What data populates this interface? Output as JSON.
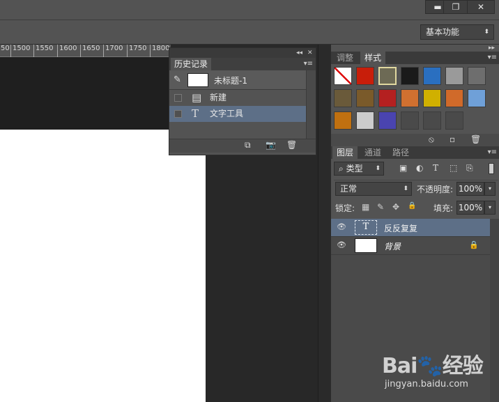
{
  "window": {
    "controls": {
      "minimize": "▬",
      "restore": "❐",
      "close": "✕"
    },
    "workspace": {
      "value": "基本功能",
      "arrow": "⬍"
    }
  },
  "ruler": {
    "ticks": [
      "50",
      "1500",
      "1550",
      "1600",
      "1650",
      "1700",
      "1750",
      "1800"
    ]
  },
  "history_panel": {
    "collapse_glyph": "◂◂",
    "close_glyph": "✕",
    "tab": "历史记录",
    "menu_glyph": "▾≡",
    "snapshot": {
      "label": "未标题-1",
      "icon": "brush-icon"
    },
    "rows": [
      {
        "label": "新建",
        "icon": "document-icon",
        "glyph": "▤"
      },
      {
        "label": "文字工具",
        "icon": "text-tool-icon",
        "glyph": "T"
      }
    ],
    "footer": {
      "new_doc": "⧉",
      "snapshot": "📷",
      "delete": "🗑"
    }
  },
  "styles_panel": {
    "expand_glyph": "▸▸",
    "tabs": [
      "调整",
      "样式"
    ],
    "active_tab": "样式",
    "menu_glyph": "▾≡",
    "swatch_colors": [
      "#ffffff",
      "#c81e0a",
      "#6d6a55",
      "#1a1a1a",
      "#2a6fc0",
      "#9a9a9a",
      "#6e6e6e",
      "#6a5a3a",
      "#7a5a2a",
      "#b42020",
      "#d07030",
      "#d0b000",
      "#d06a2a",
      "#6fa0d8",
      "#c07010",
      "#cccccc",
      "#4a44b0",
      "#4a4a4a",
      "#4a4a4a",
      "#4a4a4a"
    ],
    "footer": {
      "clear": "⦸",
      "new": "▫",
      "delete": "🗑"
    }
  },
  "layers_panel": {
    "tabs": [
      "图层",
      "通道",
      "路径"
    ],
    "active_tab": "图层",
    "menu_glyph": "▾≡",
    "filter": {
      "prefix": "⌕",
      "value": "类型",
      "arrow": "⬍"
    },
    "filter_icons": [
      "▣",
      "◐",
      "T",
      "⬚",
      "⎘"
    ],
    "blend": {
      "value": "正常",
      "arrow": "⬍"
    },
    "opacity": {
      "label": "不透明度:",
      "value": "100%",
      "arrow": "▾"
    },
    "lock": {
      "label": "锁定:",
      "icons": [
        "▦",
        "✎",
        "✥",
        "🔒"
      ]
    },
    "fill": {
      "label": "填充:",
      "value": "100%",
      "arrow": "▾"
    },
    "layers": [
      {
        "name": "反反复复",
        "thumb_glyph": "T",
        "visible": true,
        "selected": true
      },
      {
        "name": "背景",
        "visible": true,
        "locked": true,
        "lock_glyph": "🔒"
      }
    ],
    "eye_glyph": "👁"
  },
  "watermark": {
    "brand": "Bai🐾经验",
    "url": "jingyan.baidu.com"
  }
}
